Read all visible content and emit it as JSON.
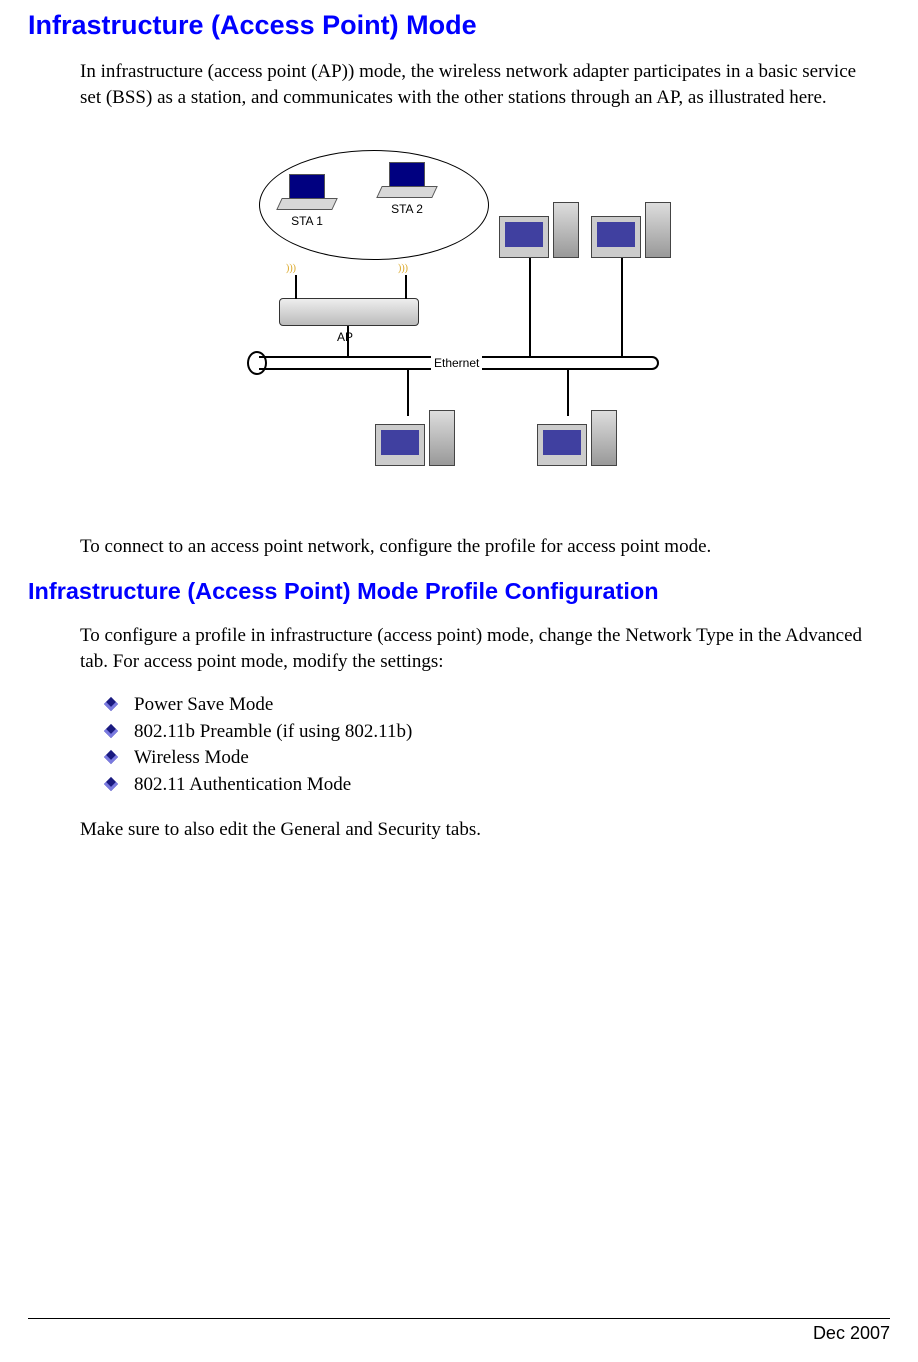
{
  "headings": {
    "h1": "Infrastructure (Access Point) Mode",
    "h2": "Infrastructure (Access Point) Mode Profile Configuration"
  },
  "paragraphs": {
    "p1": "In infrastructure (access point (AP)) mode, the wireless network adapter participates in a basic service set (BSS) as a station, and communicates with the other stations through an AP, as illustrated here.",
    "p2": "To connect to an access point network, configure the profile for access point mode.",
    "p3": "To configure a profile in infrastructure (access point) mode, change the Network Type in the Advanced tab. For access point mode, modify the settings:",
    "p4": "Make sure to also edit the General and Security tabs."
  },
  "diagram": {
    "sta1": "STA 1",
    "sta2": "STA 2",
    "ap": "AP",
    "ethernet": "Ethernet"
  },
  "bullets": [
    "Power Save Mode",
    "802.11b Preamble (if using 802.11b)",
    "Wireless Mode",
    "802.11 Authentication Mode"
  ],
  "footer": {
    "date": "Dec 2007"
  }
}
